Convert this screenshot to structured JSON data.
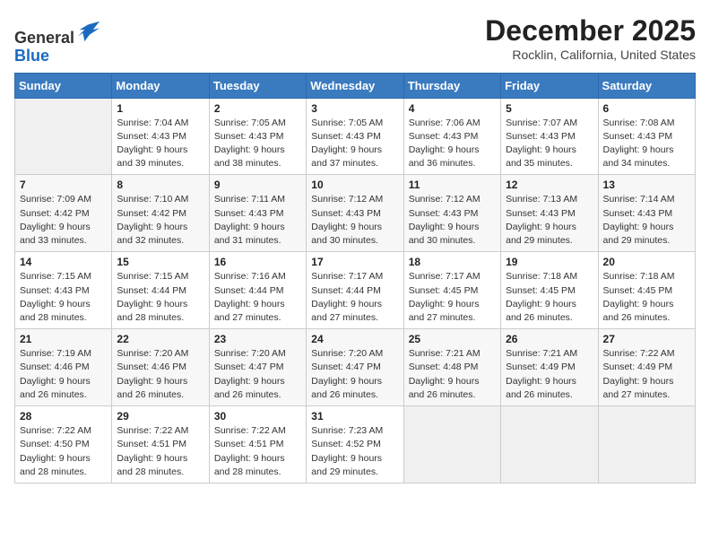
{
  "header": {
    "logo_line1": "General",
    "logo_line2": "Blue",
    "month_title": "December 2025",
    "location": "Rocklin, California, United States"
  },
  "weekdays": [
    "Sunday",
    "Monday",
    "Tuesday",
    "Wednesday",
    "Thursday",
    "Friday",
    "Saturday"
  ],
  "weeks": [
    [
      {
        "day": "",
        "empty": true
      },
      {
        "day": "1",
        "sunrise": "7:04 AM",
        "sunset": "4:43 PM",
        "daylight": "9 hours and 39 minutes."
      },
      {
        "day": "2",
        "sunrise": "7:05 AM",
        "sunset": "4:43 PM",
        "daylight": "9 hours and 38 minutes."
      },
      {
        "day": "3",
        "sunrise": "7:05 AM",
        "sunset": "4:43 PM",
        "daylight": "9 hours and 37 minutes."
      },
      {
        "day": "4",
        "sunrise": "7:06 AM",
        "sunset": "4:43 PM",
        "daylight": "9 hours and 36 minutes."
      },
      {
        "day": "5",
        "sunrise": "7:07 AM",
        "sunset": "4:43 PM",
        "daylight": "9 hours and 35 minutes."
      },
      {
        "day": "6",
        "sunrise": "7:08 AM",
        "sunset": "4:43 PM",
        "daylight": "9 hours and 34 minutes."
      }
    ],
    [
      {
        "day": "7",
        "sunrise": "7:09 AM",
        "sunset": "4:42 PM",
        "daylight": "9 hours and 33 minutes."
      },
      {
        "day": "8",
        "sunrise": "7:10 AM",
        "sunset": "4:42 PM",
        "daylight": "9 hours and 32 minutes."
      },
      {
        "day": "9",
        "sunrise": "7:11 AM",
        "sunset": "4:43 PM",
        "daylight": "9 hours and 31 minutes."
      },
      {
        "day": "10",
        "sunrise": "7:12 AM",
        "sunset": "4:43 PM",
        "daylight": "9 hours and 30 minutes."
      },
      {
        "day": "11",
        "sunrise": "7:12 AM",
        "sunset": "4:43 PM",
        "daylight": "9 hours and 30 minutes."
      },
      {
        "day": "12",
        "sunrise": "7:13 AM",
        "sunset": "4:43 PM",
        "daylight": "9 hours and 29 minutes."
      },
      {
        "day": "13",
        "sunrise": "7:14 AM",
        "sunset": "4:43 PM",
        "daylight": "9 hours and 29 minutes."
      }
    ],
    [
      {
        "day": "14",
        "sunrise": "7:15 AM",
        "sunset": "4:43 PM",
        "daylight": "9 hours and 28 minutes."
      },
      {
        "day": "15",
        "sunrise": "7:15 AM",
        "sunset": "4:44 PM",
        "daylight": "9 hours and 28 minutes."
      },
      {
        "day": "16",
        "sunrise": "7:16 AM",
        "sunset": "4:44 PM",
        "daylight": "9 hours and 27 minutes."
      },
      {
        "day": "17",
        "sunrise": "7:17 AM",
        "sunset": "4:44 PM",
        "daylight": "9 hours and 27 minutes."
      },
      {
        "day": "18",
        "sunrise": "7:17 AM",
        "sunset": "4:45 PM",
        "daylight": "9 hours and 27 minutes."
      },
      {
        "day": "19",
        "sunrise": "7:18 AM",
        "sunset": "4:45 PM",
        "daylight": "9 hours and 26 minutes."
      },
      {
        "day": "20",
        "sunrise": "7:18 AM",
        "sunset": "4:45 PM",
        "daylight": "9 hours and 26 minutes."
      }
    ],
    [
      {
        "day": "21",
        "sunrise": "7:19 AM",
        "sunset": "4:46 PM",
        "daylight": "9 hours and 26 minutes."
      },
      {
        "day": "22",
        "sunrise": "7:20 AM",
        "sunset": "4:46 PM",
        "daylight": "9 hours and 26 minutes."
      },
      {
        "day": "23",
        "sunrise": "7:20 AM",
        "sunset": "4:47 PM",
        "daylight": "9 hours and 26 minutes."
      },
      {
        "day": "24",
        "sunrise": "7:20 AM",
        "sunset": "4:47 PM",
        "daylight": "9 hours and 26 minutes."
      },
      {
        "day": "25",
        "sunrise": "7:21 AM",
        "sunset": "4:48 PM",
        "daylight": "9 hours and 26 minutes."
      },
      {
        "day": "26",
        "sunrise": "7:21 AM",
        "sunset": "4:49 PM",
        "daylight": "9 hours and 26 minutes."
      },
      {
        "day": "27",
        "sunrise": "7:22 AM",
        "sunset": "4:49 PM",
        "daylight": "9 hours and 27 minutes."
      }
    ],
    [
      {
        "day": "28",
        "sunrise": "7:22 AM",
        "sunset": "4:50 PM",
        "daylight": "9 hours and 28 minutes."
      },
      {
        "day": "29",
        "sunrise": "7:22 AM",
        "sunset": "4:51 PM",
        "daylight": "9 hours and 28 minutes."
      },
      {
        "day": "30",
        "sunrise": "7:22 AM",
        "sunset": "4:51 PM",
        "daylight": "9 hours and 28 minutes."
      },
      {
        "day": "31",
        "sunrise": "7:23 AM",
        "sunset": "4:52 PM",
        "daylight": "9 hours and 29 minutes."
      },
      {
        "day": "",
        "empty": true
      },
      {
        "day": "",
        "empty": true
      },
      {
        "day": "",
        "empty": true
      }
    ]
  ],
  "labels": {
    "sunrise_prefix": "Sunrise: ",
    "sunset_prefix": "Sunset: ",
    "daylight_prefix": "Daylight: "
  }
}
